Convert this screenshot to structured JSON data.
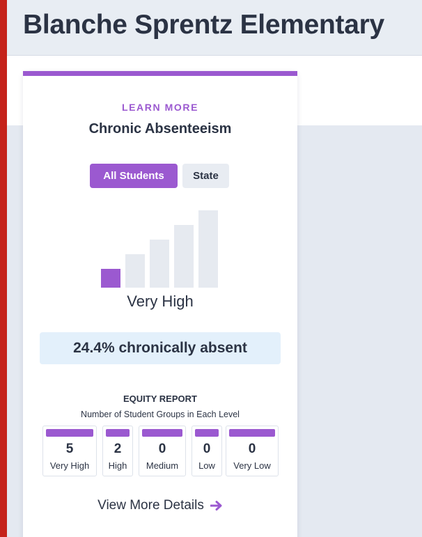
{
  "header": {
    "school_name": "Blanche Sprentz Elementary"
  },
  "card": {
    "eyebrow": "LEARN MORE",
    "title": "Chronic Absenteeism",
    "tabs": [
      {
        "label": "All Students",
        "active": true
      },
      {
        "label": "State",
        "active": false
      }
    ],
    "level_indicator": {
      "levels_total": 5,
      "levels_filled": 1,
      "level_label": "Very High"
    },
    "rate_text": "24.4% chronically absent",
    "equity": {
      "title": "EQUITY REPORT",
      "subtitle": "Number of Student Groups in Each Level",
      "levels": [
        {
          "count": "5",
          "label": "Very High"
        },
        {
          "count": "2",
          "label": "High"
        },
        {
          "count": "0",
          "label": "Medium"
        },
        {
          "count": "0",
          "label": "Low"
        },
        {
          "count": "0",
          "label": "Very Low"
        }
      ]
    },
    "link": {
      "label": "View More Details",
      "icon": "arrow-right-icon"
    }
  },
  "colors": {
    "accent": "#9b59d0",
    "text": "#2b3344",
    "background": "#e4e9f1",
    "bar_off": "#e6eaf0",
    "rate_bg": "#e3f0fb",
    "outer_border": "#c5231b"
  }
}
